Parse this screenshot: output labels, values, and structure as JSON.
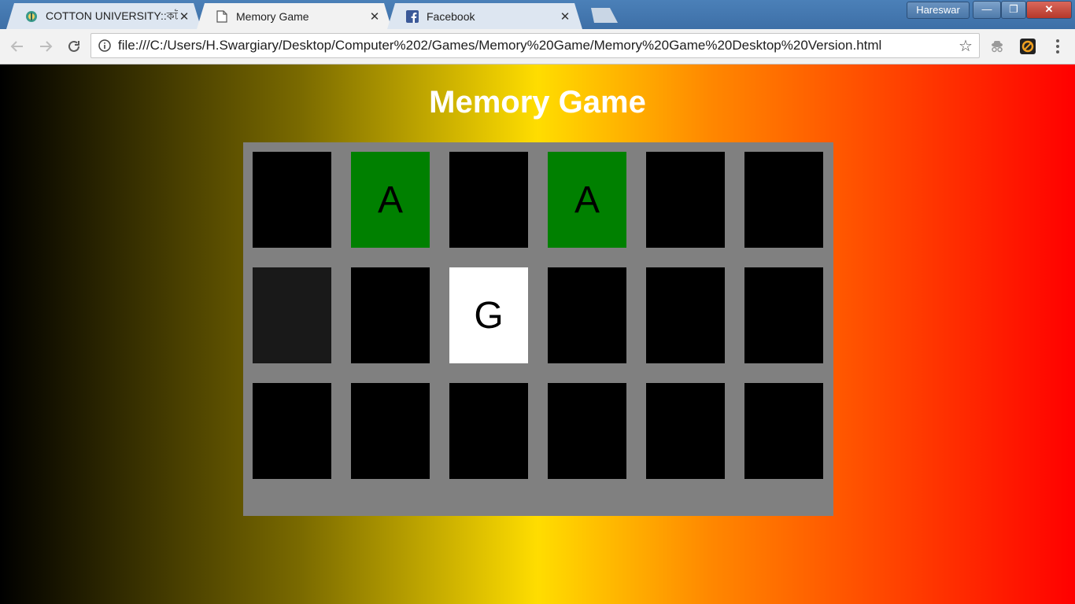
{
  "browser": {
    "tabs": [
      {
        "title": "COTTON UNIVERSITY::কট",
        "icon": "university-logo-icon",
        "active": false
      },
      {
        "title": "Memory Game",
        "icon": "page-icon",
        "active": true
      },
      {
        "title": "Facebook",
        "icon": "facebook-icon",
        "active": false
      }
    ],
    "profile_name": "Hareswar",
    "window_controls": {
      "minimize": "—",
      "restore": "❐",
      "close": "✕"
    },
    "url": "file:///C:/Users/H.Swargiary/Desktop/Computer%202/Games/Memory%20Game/Memory%20Game%20Desktop%20Version.html",
    "close_glyph": "✕"
  },
  "page": {
    "title": "Memory Game",
    "background_colors": [
      "#000000",
      "#7a6a00",
      "#ffdd00",
      "#ff8800",
      "#ff0000"
    ],
    "board_color": "#808080"
  },
  "cards": [
    {
      "state": "hidden",
      "letter": ""
    },
    {
      "state": "matched",
      "letter": "A"
    },
    {
      "state": "hidden",
      "letter": ""
    },
    {
      "state": "matched",
      "letter": "A"
    },
    {
      "state": "hidden",
      "letter": ""
    },
    {
      "state": "hidden",
      "letter": ""
    },
    {
      "state": "hover",
      "letter": ""
    },
    {
      "state": "hidden",
      "letter": ""
    },
    {
      "state": "revealed",
      "letter": "G"
    },
    {
      "state": "hidden",
      "letter": ""
    },
    {
      "state": "hidden",
      "letter": ""
    },
    {
      "state": "hidden",
      "letter": ""
    },
    {
      "state": "hidden",
      "letter": ""
    },
    {
      "state": "hidden",
      "letter": ""
    },
    {
      "state": "hidden",
      "letter": ""
    },
    {
      "state": "hidden",
      "letter": ""
    },
    {
      "state": "hidden",
      "letter": ""
    },
    {
      "state": "hidden",
      "letter": ""
    }
  ]
}
